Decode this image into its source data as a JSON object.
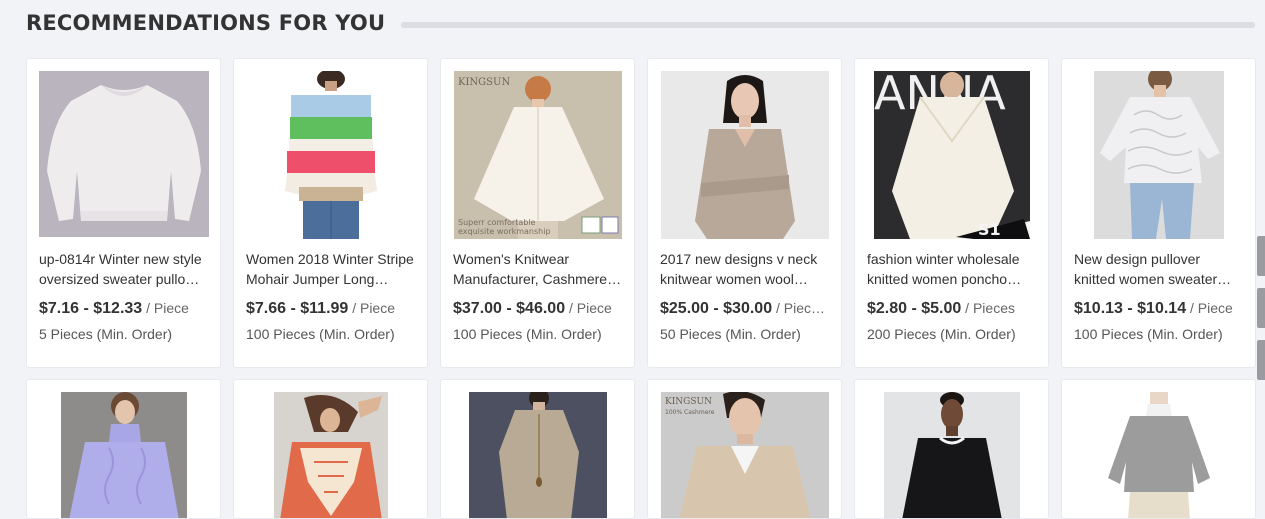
{
  "section": {
    "title": "RECOMMENDATIONS FOR YOU"
  },
  "products": [
    {
      "title_line1": "up-0814r Winter new style",
      "title_line2": "oversized sweater pullo…",
      "price": "$7.16 - $12.33",
      "unit": " / Piece",
      "moq": "5 Pieces (Min. Order)"
    },
    {
      "title_line1": "Women 2018 Winter Stripe",
      "title_line2": "Mohair Jumper Long…",
      "price": "$7.66 - $11.99",
      "unit": " / Piece",
      "moq": "100 Pieces (Min. Order)"
    },
    {
      "title_line1": "Women's Knitwear",
      "title_line2": "Manufacturer, Cashmere…",
      "price": "$37.00 - $46.00",
      "unit": " / Piece",
      "moq": "100 Pieces (Min. Order)",
      "watermark": "KINGSUN",
      "caption1": "Superr comfortable",
      "caption2": "exquisite workmanship"
    },
    {
      "title_line1": "2017 new designs v neck",
      "title_line2": "knitwear women wool…",
      "price": "$25.00 - $30.00",
      "unit": " / Piec…",
      "moq": "50 Pieces (Min. Order)"
    },
    {
      "title_line1": "fashion winter wholesale",
      "title_line2": "knitted women poncho…",
      "price": "$2.80 - $5.00",
      "unit": " / Pieces",
      "moq": "200 Pieces (Min. Order)",
      "banner": "ANNA",
      "bag_text": "S1"
    },
    {
      "title_line1": "New design pullover",
      "title_line2": "knitted women sweater…",
      "price": "$10.13 - $10.14",
      "unit": " / Piece",
      "moq": "100 Pieces (Min. Order)"
    }
  ],
  "row2_products": [
    {
      "name": "lavender turtleneck sweater"
    },
    {
      "name": "crochet fringe poncho"
    },
    {
      "name": "taupe knit dress"
    },
    {
      "name": "beige v-neck men sweater",
      "watermark": "KINGSUN",
      "caption": "100% Cashmere"
    },
    {
      "name": "black crew neck men sweater"
    },
    {
      "name": "grey turtleneck women sweater"
    }
  ]
}
